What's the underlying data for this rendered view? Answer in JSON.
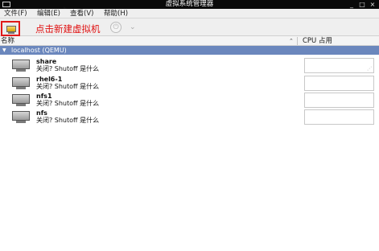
{
  "window": {
    "title": "虚拟系统管理器",
    "minimize_glyph": "_",
    "maximize_glyph": "□",
    "close_glyph": "×"
  },
  "menubar": {
    "items": [
      {
        "label": "文件(F)"
      },
      {
        "label": "编辑(E)"
      },
      {
        "label": "查看(V)"
      },
      {
        "label": "帮助(H)"
      }
    ]
  },
  "toolbar": {
    "new_vm_icon": "new-vm-monitor-icon",
    "annotation": "点击新建虚拟机",
    "power_glyph": "⏻",
    "dropdown_glyph": "⌄"
  },
  "columns": {
    "name": "名称",
    "sort_glyph": "⌃",
    "cpu": "CPU 占用"
  },
  "host": {
    "expander_glyph": "▼",
    "label": "localhost (QEMU)"
  },
  "vms": [
    {
      "name": "share",
      "status": "关闭? Shutoff 是什么"
    },
    {
      "name": "rhel6-1",
      "status": "关闭? Shutoff 是什么"
    },
    {
      "name": "nfs1",
      "status": "关闭? Shutoff 是什么"
    },
    {
      "name": "nfs",
      "status": "关闭? Shutoff 是什么"
    }
  ],
  "colors": {
    "annotation": "#e01010",
    "host_row": "#6b87bd",
    "titlebar": "#0a0a0a"
  }
}
